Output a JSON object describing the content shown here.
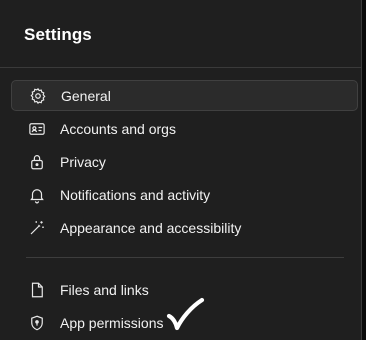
{
  "settings": {
    "title": "Settings",
    "items": [
      {
        "label": "General",
        "icon": "gear-icon",
        "selected": true
      },
      {
        "label": "Accounts and orgs",
        "icon": "id-card-icon",
        "selected": false
      },
      {
        "label": "Privacy",
        "icon": "lock-icon",
        "selected": false
      },
      {
        "label": "Notifications and activity",
        "icon": "bell-icon",
        "selected": false
      },
      {
        "label": "Appearance and accessibility",
        "icon": "magic-wand-icon",
        "selected": false
      },
      {
        "label": "Files and links",
        "icon": "file-icon",
        "selected": false
      },
      {
        "label": "App permissions",
        "icon": "shield-icon",
        "selected": false
      }
    ]
  },
  "colors": {
    "background": "#1f1f1f",
    "selected_bg": "#2b2b2b",
    "text": "#f2f2f2",
    "annotation": "#ffffff"
  }
}
